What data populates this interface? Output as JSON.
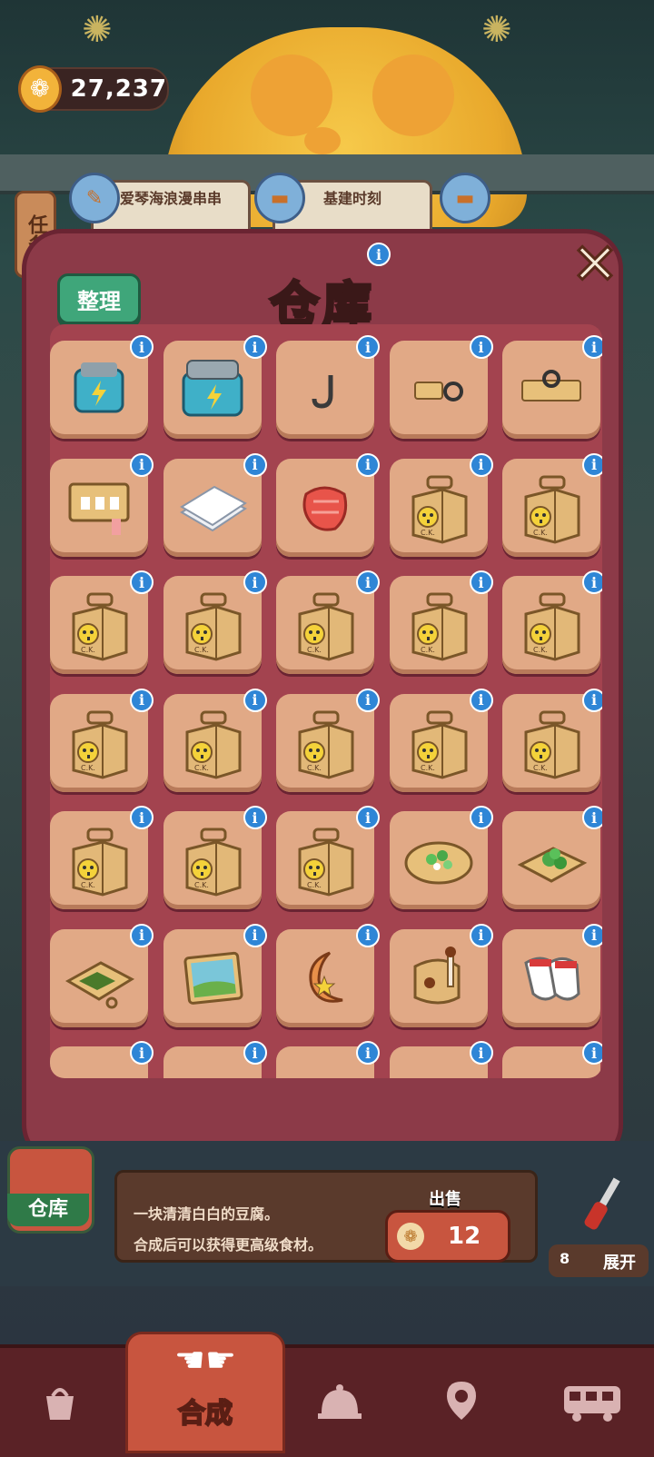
{
  "currency": {
    "amount": "27,237",
    "icon": "paw-coin-icon"
  },
  "tasks": {
    "side_label": "任务",
    "cards": [
      {
        "title": "爱琴海浪漫串串"
      },
      {
        "title": "基建时刻"
      }
    ]
  },
  "warehouse_modal": {
    "title": "仓库",
    "sort_label": "整理",
    "close_label": "✕",
    "info_glyph": "i",
    "items": [
      "battery-icon",
      "large-battery-icon",
      "hook-icon",
      "plug-connector-icon",
      "socket-connector-icon",
      "spice-rack-icon",
      "paper-stack-icon",
      "raw-meat-icon",
      "takeout-box-icon",
      "takeout-box-icon",
      "takeout-box-icon",
      "takeout-box-icon",
      "takeout-box-icon",
      "takeout-box-icon",
      "takeout-box-icon",
      "takeout-box-icon",
      "takeout-box-icon",
      "takeout-box-icon",
      "takeout-box-icon",
      "takeout-box-icon",
      "takeout-box-icon",
      "takeout-box-icon",
      "takeout-box-icon",
      "scallion-pancake-icon",
      "herb-board-icon",
      "seaweed-tray-icon",
      "picture-puzzle-icon",
      "moon-ornament-icon",
      "drum-icon",
      "rubber-gloves-icon",
      "partial-item-icon",
      "partial-item-icon",
      "partial-item-icon",
      "partial-item-icon",
      "partial-item-icon"
    ],
    "box_label": "C.K."
  },
  "detail_panel": {
    "warehouse_button": "仓库",
    "desc_line1": "一块清清白白的豆腐。",
    "desc_line2": "合成后可以获得更高级食材。",
    "sell_label": "出售",
    "sell_price": "12",
    "expand_count": "8",
    "expand_label": "展开"
  },
  "bottom_nav": {
    "active_label": "合成",
    "items": [
      "bag-icon",
      "merge-icon",
      "cloche-icon",
      "map-pin-icon",
      "bus-icon"
    ]
  },
  "colors": {
    "modal": "#8c3a48",
    "slot": "#e1a986",
    "info": "#2f86d6",
    "sort": "#3fa67a"
  }
}
